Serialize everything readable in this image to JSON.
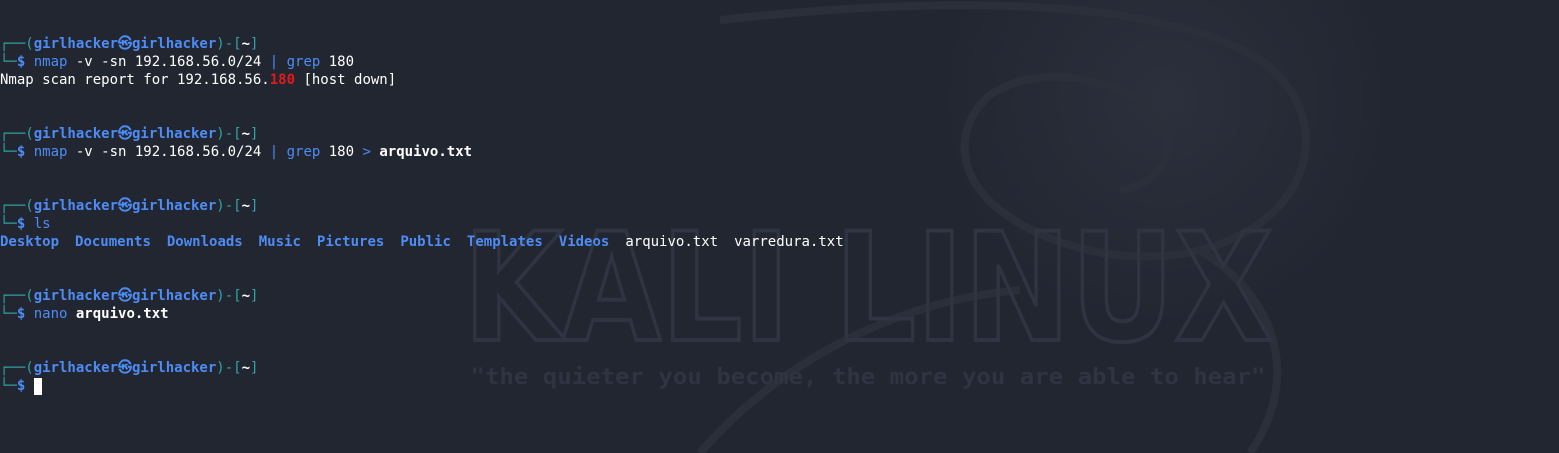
{
  "prompt": {
    "open_bracket": "┌──(",
    "user_host": "girlhacker㉿girlhacker",
    "mid": ")-[",
    "dir": "~",
    "close": "]",
    "corner": "└─",
    "dollar": "$ "
  },
  "blocks": [
    {
      "cmd": "nmap",
      "rest": " -v -sn 192.168.56.0/24 ",
      "pipe": "|",
      "grep": " grep",
      "tail": " 180"
    },
    {
      "cmd": "nmap",
      "rest": " -v -sn 192.168.56.0/24 ",
      "pipe": "|",
      "grep": " grep",
      "tail": " 180 ",
      "redir": ">",
      "file": " arquivo.txt"
    },
    {
      "cmd": "ls"
    },
    {
      "cmd": "nano",
      "file": " arquivo.txt"
    }
  ],
  "outputs": {
    "nmap_prefix": "Nmap scan report for 192.168.56.",
    "nmap_hl": "180",
    "nmap_suffix": " [host down]"
  },
  "ls_dirs": [
    "Desktop",
    "Documents",
    "Downloads",
    "Music",
    "Pictures",
    "Public",
    "Templates",
    "Videos"
  ],
  "ls_files": [
    "arquivo.txt",
    "varredura.txt"
  ],
  "wallpaper": {
    "title": "KALI LINUX",
    "slogan": "\"the quieter you become, the more you are able to hear\""
  }
}
